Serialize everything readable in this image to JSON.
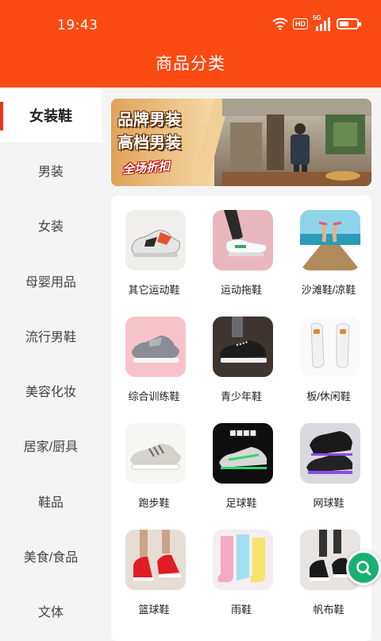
{
  "status_bar": {
    "time": "19:43",
    "hd": "HD",
    "network": "5G"
  },
  "header": {
    "title": "商品分类"
  },
  "sidebar": {
    "items": [
      {
        "label": "女装鞋",
        "active": true
      },
      {
        "label": "男装"
      },
      {
        "label": "女装"
      },
      {
        "label": "母婴用品"
      },
      {
        "label": "流行男鞋"
      },
      {
        "label": "美容化妆"
      },
      {
        "label": "居家/厨具"
      },
      {
        "label": "鞋品"
      },
      {
        "label": "美食/食品"
      },
      {
        "label": "文体"
      }
    ]
  },
  "banner": {
    "line1": "品牌男装",
    "line2": "高档男装",
    "slogan": "全场折扣"
  },
  "grid": {
    "items": [
      {
        "label": "其它运动鞋",
        "icon": "sneaker-photo"
      },
      {
        "label": "运动拖鞋",
        "icon": "slip-on-photo"
      },
      {
        "label": "沙滩鞋/凉鞋",
        "icon": "beach-sandal-photo"
      },
      {
        "label": "综合训练鞋",
        "icon": "training-shoe-photo"
      },
      {
        "label": "青少年鞋",
        "icon": "canvas-sneaker-photo"
      },
      {
        "label": "板/休闲鞋",
        "icon": "white-casual-shoe-photo"
      },
      {
        "label": "跑步鞋",
        "icon": "running-shoe-photo"
      },
      {
        "label": "足球鞋",
        "icon": "football-shoe-photo"
      },
      {
        "label": "网球鞋",
        "icon": "tennis-shoe-photo"
      },
      {
        "label": "篮球鞋",
        "icon": "red-knit-shoe-photo"
      },
      {
        "label": "雨鞋",
        "icon": "rain-boot-photo"
      },
      {
        "label": "帆布鞋",
        "icon": "canvas-shoe-photo"
      }
    ]
  },
  "float_button": {
    "icon": "search-icon"
  },
  "colors": {
    "brand": "#fb4a12",
    "active_marker": "#e8341c",
    "float_button": "#1ab073"
  }
}
